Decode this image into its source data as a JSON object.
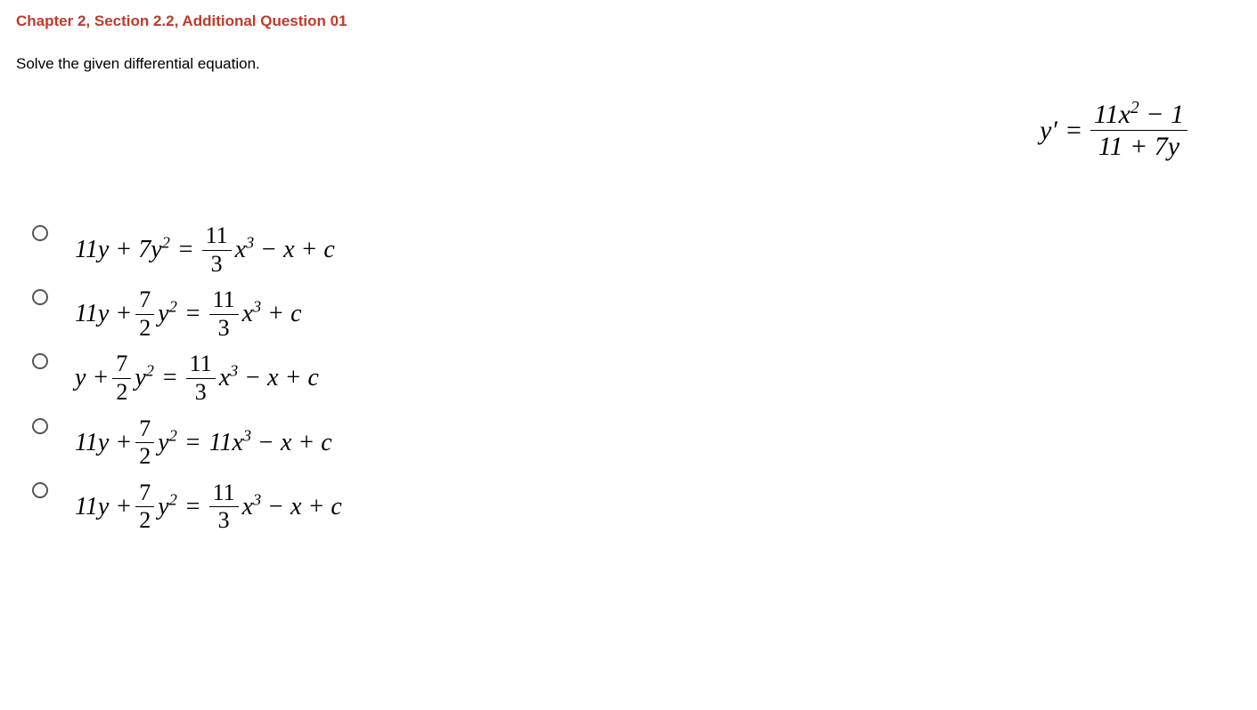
{
  "title": "Chapter 2, Section 2.2, Additional Question 01",
  "prompt": "Solve the given differential equation.",
  "equation": {
    "lhs": "y′",
    "eq": "=",
    "num": "11x² − 1",
    "den": "11 + 7y"
  },
  "options": [
    {
      "left": "11y + 7y²",
      "eq": "=",
      "right_prefix_frac": {
        "num": "11",
        "den": "3"
      },
      "right_suffix": "x³ − x + c"
    },
    {
      "left_prefix": "11y +",
      "left_frac": {
        "num": "7",
        "den": "2"
      },
      "left_suffix": "y²",
      "eq": "=",
      "right_prefix_frac": {
        "num": "11",
        "den": "3"
      },
      "right_suffix": "x³ + c"
    },
    {
      "left_prefix": "y +",
      "left_frac": {
        "num": "7",
        "den": "2"
      },
      "left_suffix": "y²",
      "eq": "=",
      "right_prefix_frac": {
        "num": "11",
        "den": "3"
      },
      "right_suffix": "x³ − x + c"
    },
    {
      "left_prefix": "11y +",
      "left_frac": {
        "num": "7",
        "den": "2"
      },
      "left_suffix": "y²",
      "eq": "=",
      "right_plain": "11x³ − x + c"
    },
    {
      "left_prefix": "11y +",
      "left_frac": {
        "num": "7",
        "den": "2"
      },
      "left_suffix": "y²",
      "eq": "=",
      "right_prefix_frac": {
        "num": "11",
        "den": "3"
      },
      "right_suffix": "x³ − x + c"
    }
  ]
}
